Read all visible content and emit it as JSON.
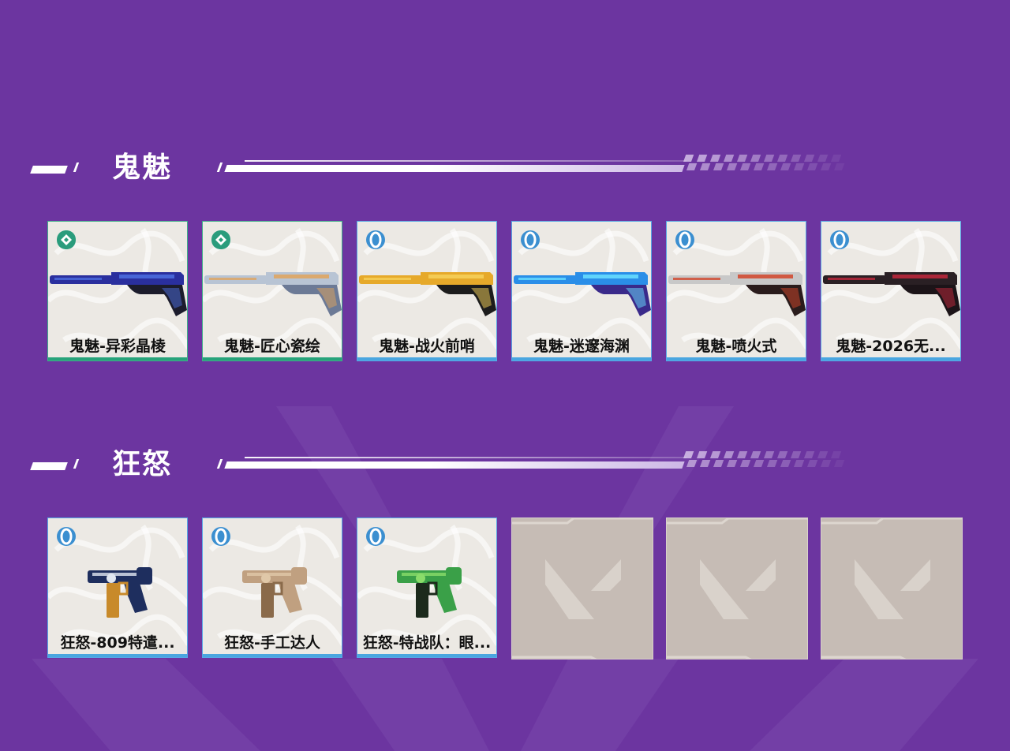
{
  "sections": [
    {
      "title": "鬼魅",
      "items": [
        {
          "name": "鬼魅-异彩晶棱",
          "tier": "select",
          "tier_color": "#2a9c7c",
          "skin": "gh-blue"
        },
        {
          "name": "鬼魅-匠心瓷绘",
          "tier": "select",
          "tier_color": "#2a9c7c",
          "skin": "gh-porcelain"
        },
        {
          "name": "鬼魅-战火前哨",
          "tier": "deluxe",
          "tier_color": "#3b8fd0",
          "skin": "gh-gold"
        },
        {
          "name": "鬼魅-迷邃海渊",
          "tier": "deluxe",
          "tier_color": "#3b8fd0",
          "skin": "gh-ocean"
        },
        {
          "name": "鬼魅-喷火式",
          "tier": "deluxe",
          "tier_color": "#3b8fd0",
          "skin": "gh-fire"
        },
        {
          "name": "鬼魅-2026无...",
          "tier": "deluxe",
          "tier_color": "#3b8fd0",
          "skin": "gh-dark"
        }
      ],
      "empty_slots": 0
    },
    {
      "title": "狂怒",
      "items": [
        {
          "name": "狂怒-809特遣...",
          "tier": "deluxe",
          "tier_color": "#3b8fd0",
          "skin": "fr-navy"
        },
        {
          "name": "狂怒-手工达人",
          "tier": "deluxe",
          "tier_color": "#3b8fd0",
          "skin": "fr-tan"
        },
        {
          "name": "狂怒-特战队：眼...",
          "tier": "deluxe",
          "tier_color": "#3b8fd0",
          "skin": "fr-green"
        }
      ],
      "empty_slots": 3
    }
  ],
  "colors": {
    "background": "#6c35a0",
    "card_bg": "#ece9e4",
    "empty_slot_bg": "#c6bcb5",
    "deluxe_border": "#56a8e6",
    "select_border": "#3fae8a"
  }
}
